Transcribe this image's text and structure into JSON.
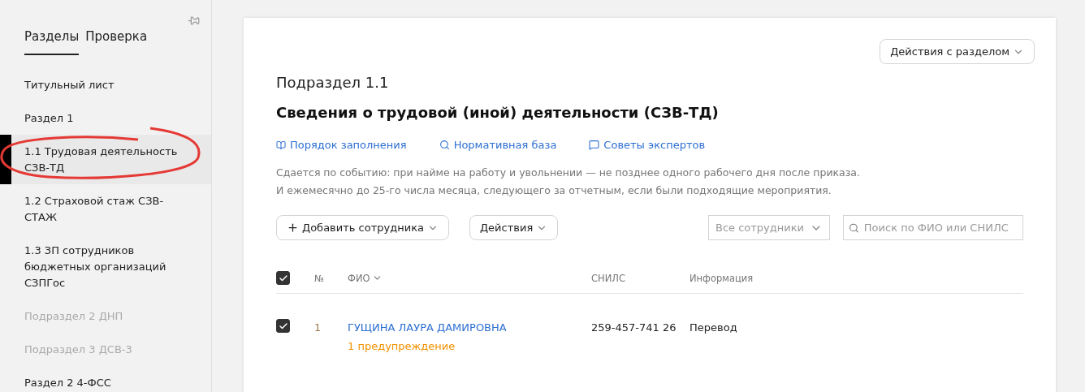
{
  "sidebar": {
    "tabs": [
      {
        "label": "Разделы",
        "selected": true
      },
      {
        "label": "Проверка",
        "selected": false
      }
    ],
    "items": [
      {
        "label": "Титульный лист",
        "selected": false,
        "disabled": false
      },
      {
        "label": "Раздел 1",
        "selected": false,
        "disabled": false
      },
      {
        "label": "1.1 Трудовая деятельность СЗВ-ТД",
        "selected": true,
        "disabled": false,
        "annotated": true
      },
      {
        "label": "1.2 Страховой стаж СЗВ-СТАЖ",
        "selected": false,
        "disabled": false
      },
      {
        "label": "1.3 ЗП сотрудников бюджетных организаций СЗПГос",
        "selected": false,
        "disabled": false
      },
      {
        "label": "Подраздел 2 ДНП",
        "selected": false,
        "disabled": true
      },
      {
        "label": "Подраздел 3 ДСВ-3",
        "selected": false,
        "disabled": true
      },
      {
        "label": "Раздел 2 4-ФСС",
        "selected": false,
        "disabled": false
      }
    ]
  },
  "section_actions": "Действия с разделом",
  "subtitle": "Подраздел 1.1",
  "title": "Сведения о трудовой (иной) деятельности (СЗВ-ТД)",
  "links": [
    {
      "kind": "guide",
      "label": "Порядок заполнения"
    },
    {
      "kind": "search",
      "label": "Нормативная база"
    },
    {
      "kind": "chat",
      "label": "Советы экспертов"
    }
  ],
  "description": [
    "Сдается по событию: при найме на работу и увольнении — не позднее одного рабочего дня после приказа.",
    "И ежемесячно до 25-го числа месяца, следующего за отчетным, если были подходящие мероприятия."
  ],
  "toolbar": {
    "add": "Добавить сотрудника",
    "actions": "Действия",
    "filter": "Все сотрудники",
    "search": {
      "placeholder": "Поиск по ФИО или СНИЛС"
    }
  },
  "table": {
    "all_checked": true,
    "columns": [
      "№",
      "ФИО",
      "СНИЛС",
      "Информация"
    ],
    "rows": [
      {
        "checked": true,
        "number": "1",
        "name": "ГУЩИНА ЛАУРА ДАМИРОВНА",
        "warning": "1 предупреждение",
        "snils": "259-457-741 26",
        "info": "Перевод"
      }
    ]
  }
}
